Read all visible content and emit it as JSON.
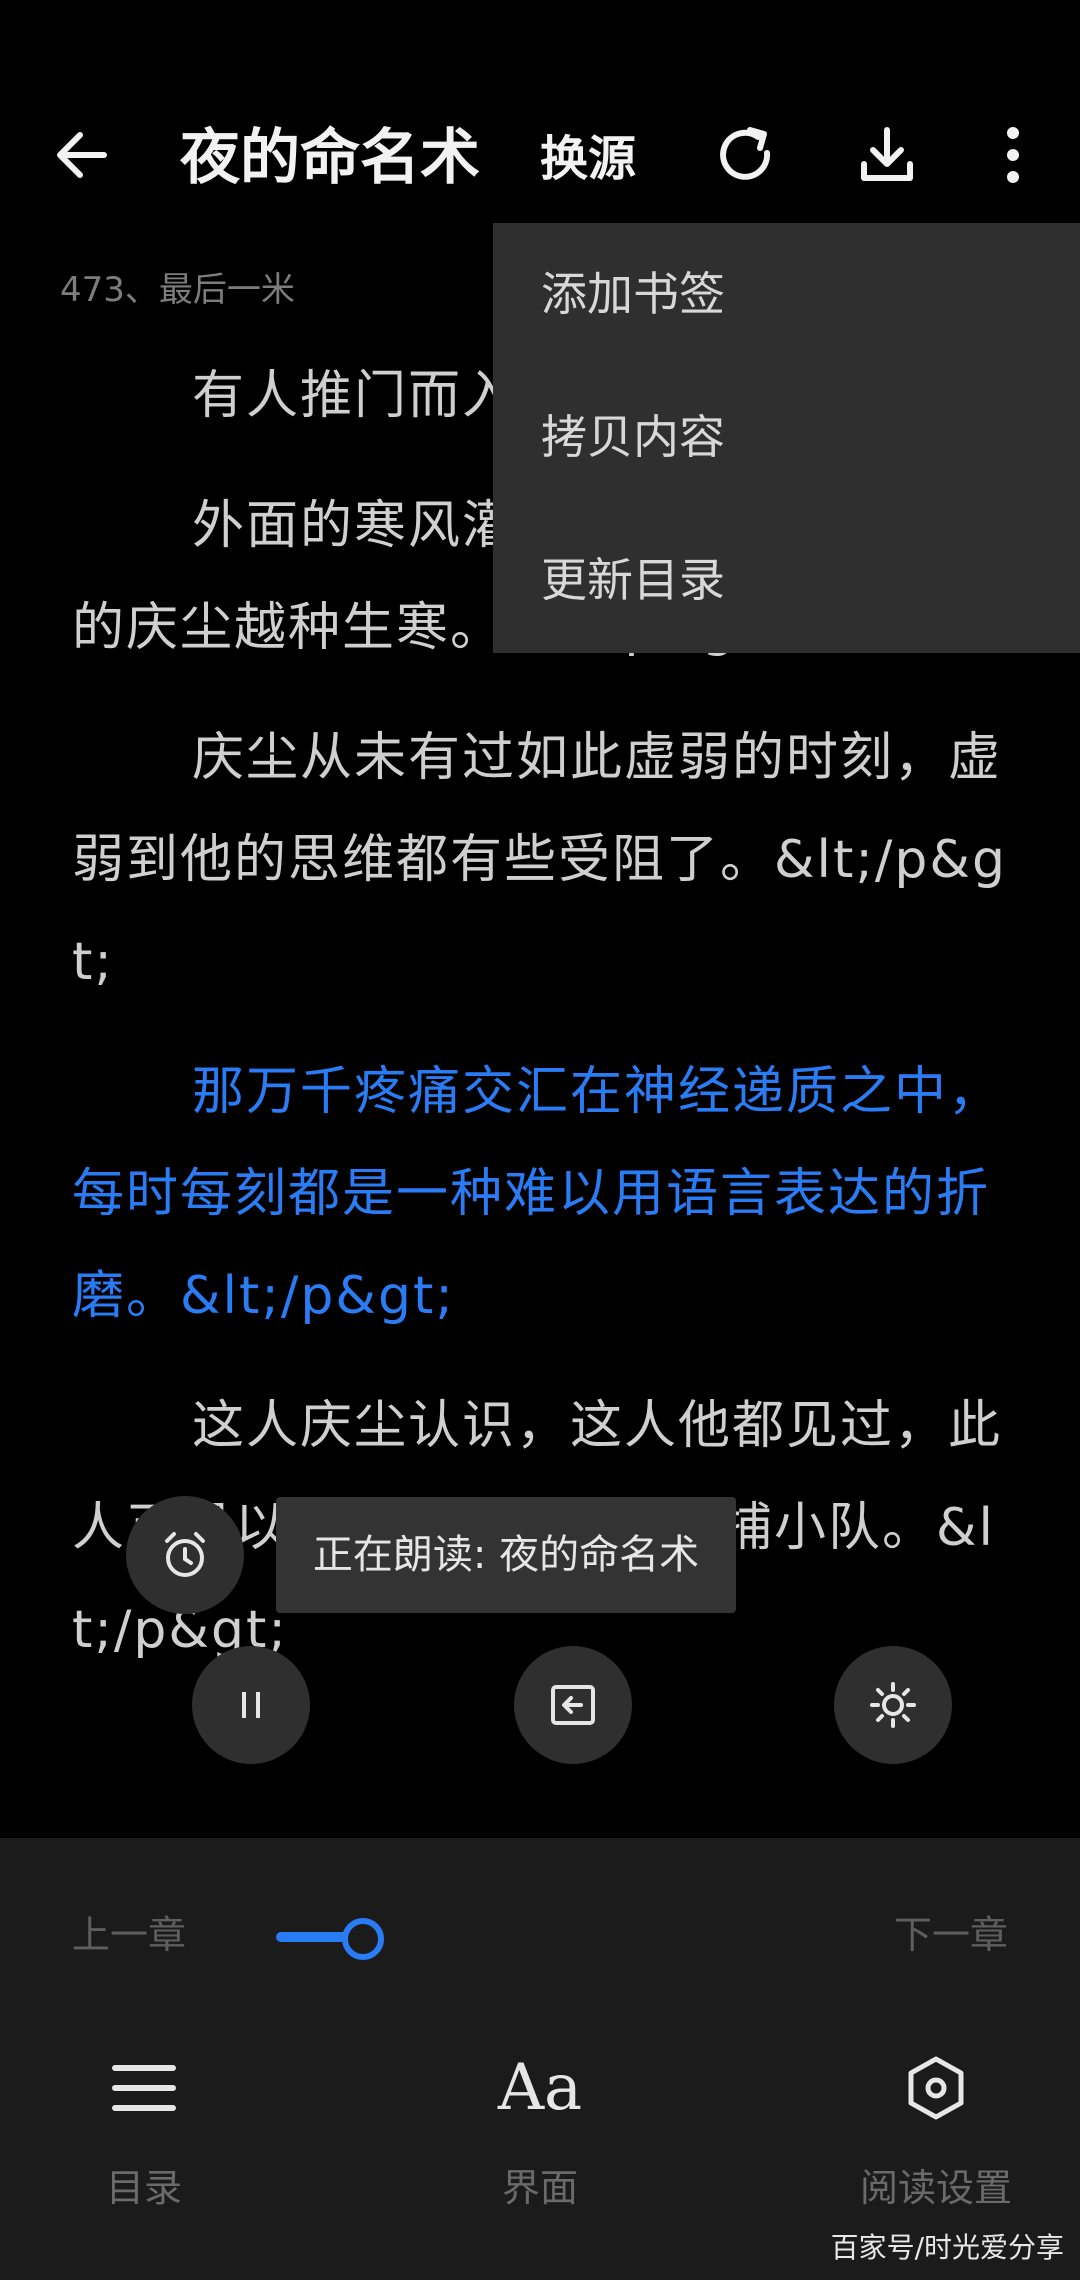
{
  "topbar": {
    "back_icon": "arrow-left-icon",
    "title": "夜的命名术",
    "source_label": "换源",
    "refresh_icon": "refresh-icon",
    "download_icon": "download-icon",
    "more_icon": "more-vertical-icon"
  },
  "chapter": {
    "title": "473、最后一米"
  },
  "content": {
    "paragraphs": [
      "有人推门而入，",
      "外面的寒风灌了进来，让本就虚弱的庆尘越种生寒。&lt;/p&gt;",
      "庆尘从未有过如此虚弱的时刻，虚弱到他的思维都有些受阻了。&lt;/p&gt;",
      "那万千疼痛交汇在神经递质之中，每时每刻都是一种难以用语言表达的折磨。&lt;/p&gt;",
      "这人庆尘认识，这人他都见过，此人正是以前跟云合为首的抓捕小队。&lt;/p&gt;"
    ],
    "highlight_index": 3,
    "highlight_color": "#2a7cf5"
  },
  "menu": {
    "items": [
      "添加书签",
      "拷贝内容",
      "更新目录"
    ]
  },
  "tts": {
    "status": "正在朗读: 夜的命名术",
    "timer_icon": "alarm-clock-icon",
    "pause_icon": "pause-icon",
    "exit_icon": "exit-reading-icon",
    "brightness_icon": "brightness-icon"
  },
  "bottom": {
    "prev_label": "上一章",
    "next_label": "下一章",
    "progress": 0.02,
    "accent_color": "#2a7cf5",
    "toc_label": "目录",
    "toc_icon": "menu-list-icon",
    "ui_label": "界面",
    "ui_icon": "font-size-icon",
    "ui_icon_text": "Aa",
    "settings_label": "阅读设置",
    "settings_icon": "settings-hexagon-icon"
  },
  "watermark": "百家号/时光爱分享"
}
